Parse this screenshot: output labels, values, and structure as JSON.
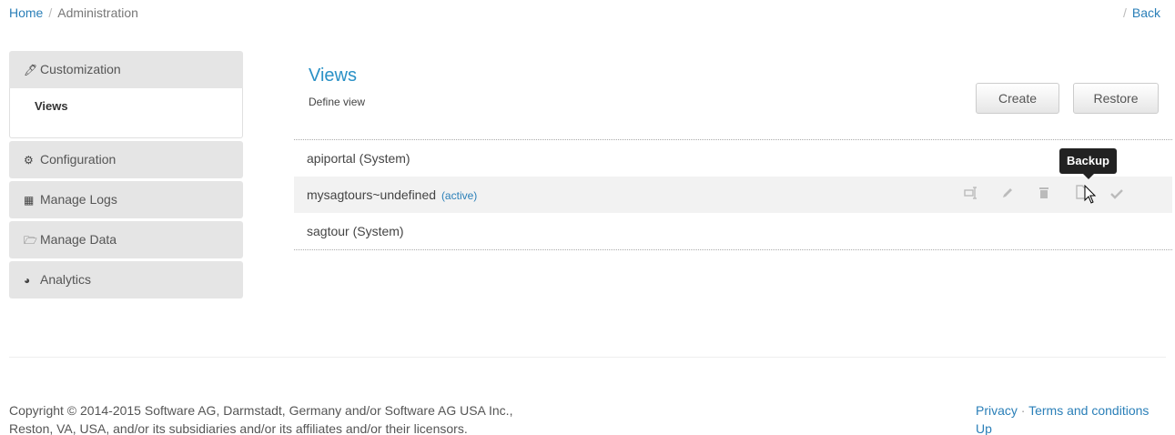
{
  "breadcrumb": {
    "home": "Home",
    "separator": "/",
    "current": "Administration"
  },
  "back": {
    "separator": "/",
    "label": "Back"
  },
  "sidebar": {
    "items": [
      {
        "label": "Customization",
        "icon": "magic-wand-icon",
        "glyph": "🖊"
      },
      {
        "label": "Configuration",
        "icon": "gears-icon",
        "glyph": "⚙"
      },
      {
        "label": "Manage Logs",
        "icon": "calendar-icon",
        "glyph": "▦"
      },
      {
        "label": "Manage Data",
        "icon": "folder-open-icon",
        "glyph": "🗁"
      },
      {
        "label": "Analytics",
        "icon": "dashboard-icon",
        "glyph": "◕"
      }
    ],
    "subitems": {
      "views": "Views"
    }
  },
  "main": {
    "title": "Views",
    "subtitle": "Define view",
    "buttons": {
      "create": "Create",
      "restore": "Restore"
    },
    "rows": [
      {
        "name": "apiportal (System)",
        "tag": ""
      },
      {
        "name": "mysagtours~undefined",
        "tag": "(active)"
      },
      {
        "name": "sagtour (System)",
        "tag": ""
      }
    ],
    "tooltip": "Backup"
  },
  "footer": {
    "copyright_line1": "Copyright © 2014-2015 Software AG, Darmstadt, Germany and/or Software AG USA Inc.,",
    "copyright_line2": "Reston, VA, USA, and/or its subsidiaries and/or its affiliates and/or their licensors.",
    "privacy": "Privacy",
    "dot": "·",
    "terms": "Terms and conditions",
    "up": "Up"
  },
  "colors": {
    "accent": "#2a7fb8",
    "title": "#2a91c6",
    "sidebar_bg": "#e5e5e5",
    "tooltip_bg": "#222222"
  }
}
